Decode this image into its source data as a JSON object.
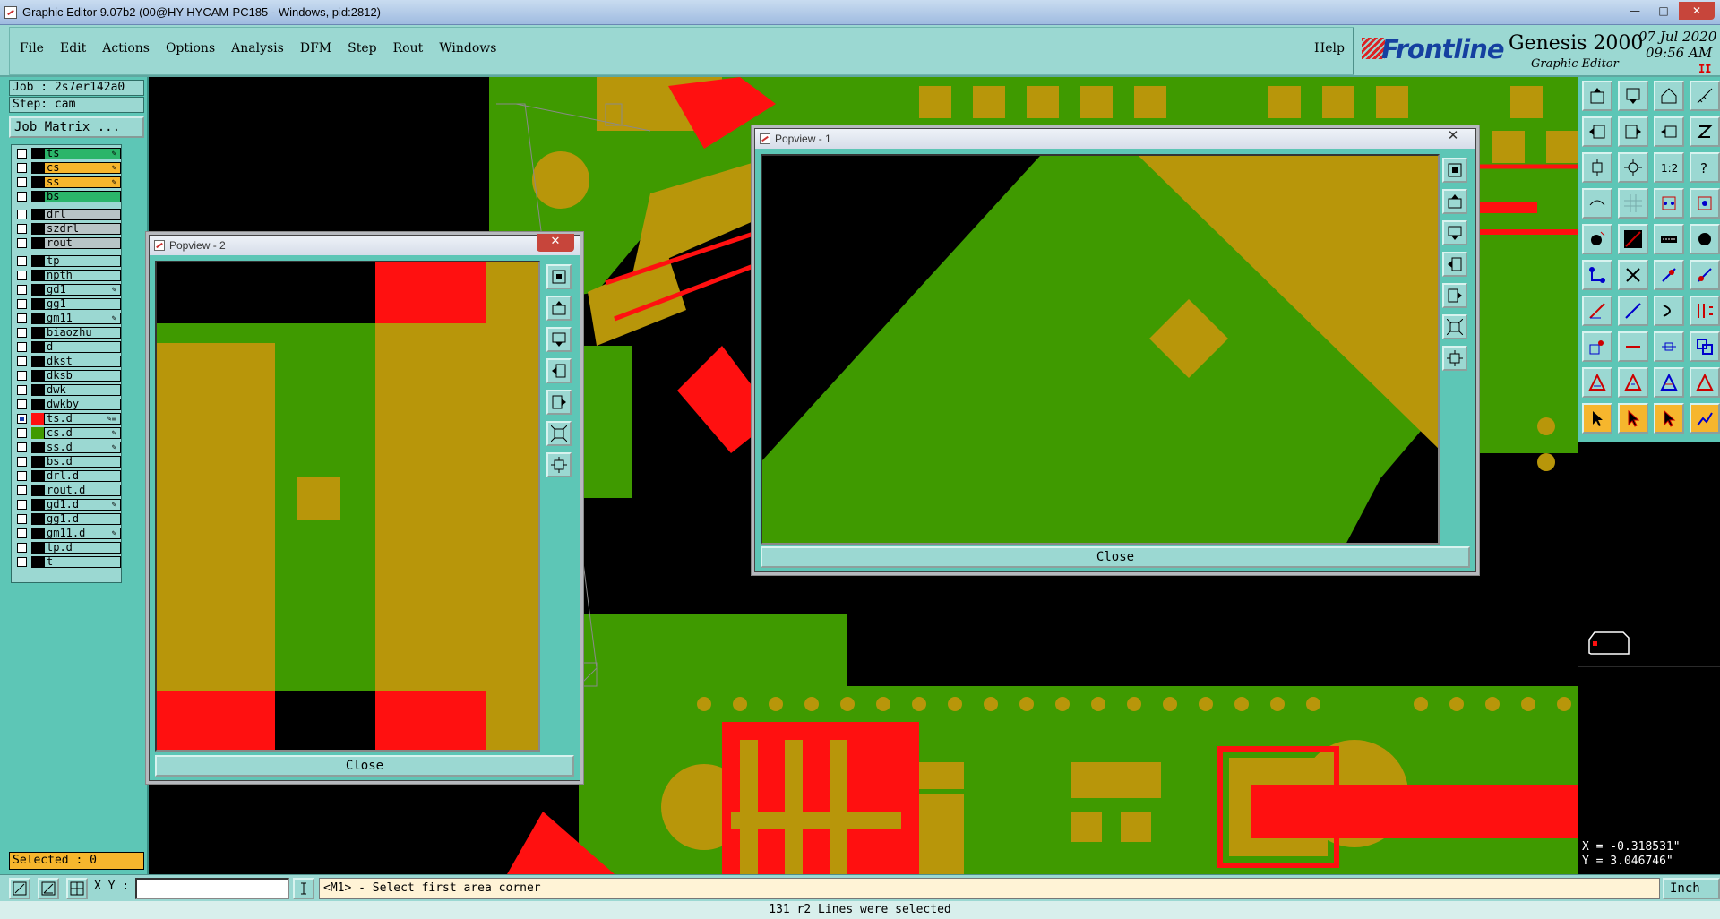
{
  "window": {
    "title": "Graphic Editor 9.07b2 (00@HY-HYCAM-PC185 - Windows, pid:2812)",
    "controls": [
      "minimize-icon",
      "maximize-icon",
      "close-icon"
    ]
  },
  "menu": {
    "items": [
      "File",
      "Edit",
      "Actions",
      "Options",
      "Analysis",
      "DFM",
      "Step",
      "Rout",
      "Windows"
    ],
    "help": "Help"
  },
  "brand": {
    "logo": "Frontline",
    "product": "Genesis 2000",
    "subtitle": "Graphic Editor",
    "date": "07 Jul 2020",
    "time": "09:56 AM",
    "pause": "II"
  },
  "job": {
    "job_label": "Job : 2s7er142a0",
    "step_label": "Step: cam",
    "matrix_button": "Job Matrix ..."
  },
  "layers": [
    {
      "name": "ts",
      "color": "#2bb56a",
      "flag": "✎",
      "group": "board"
    },
    {
      "name": "cs",
      "color": "#f6b62d",
      "flag": "✎",
      "group": "board"
    },
    {
      "name": "ss",
      "color": "#f6b62d",
      "flag": "✎",
      "group": "board"
    },
    {
      "name": "bs",
      "color": "#2bb56a",
      "flag": "",
      "group": "board"
    },
    {
      "name": "drl",
      "color": "#b8c4c6",
      "flag": "",
      "group": "drill"
    },
    {
      "name": "szdrl",
      "color": "#b8c4c6",
      "flag": "",
      "group": "drill"
    },
    {
      "name": "rout",
      "color": "#b8c4c6",
      "flag": "",
      "group": "drill"
    },
    {
      "name": "tp",
      "color": "#9bd8d2",
      "flag": "",
      "group": "misc"
    },
    {
      "name": "npth",
      "color": "#9bd8d2",
      "flag": "",
      "group": "misc"
    },
    {
      "name": "gd1",
      "color": "#9bd8d2",
      "flag": "✎",
      "group": "misc"
    },
    {
      "name": "gg1",
      "color": "#9bd8d2",
      "flag": "",
      "group": "misc"
    },
    {
      "name": "gm11",
      "color": "#9bd8d2",
      "flag": "✎",
      "group": "misc"
    },
    {
      "name": "biaozhu",
      "color": "#9bd8d2",
      "flag": "",
      "group": "misc"
    },
    {
      "name": "d",
      "color": "#9bd8d2",
      "flag": "",
      "group": "misc"
    },
    {
      "name": "dkst",
      "color": "#9bd8d2",
      "flag": "",
      "group": "misc"
    },
    {
      "name": "dksb",
      "color": "#9bd8d2",
      "flag": "",
      "group": "misc"
    },
    {
      "name": "dwk",
      "color": "#9bd8d2",
      "flag": "",
      "group": "misc"
    },
    {
      "name": "dwkby",
      "color": "#9bd8d2",
      "flag": "",
      "group": "misc"
    },
    {
      "name": "ts.d",
      "color": "#9bd8d2",
      "flag": "✎≡",
      "group": "misc",
      "swatch": "#ff1010",
      "active": true
    },
    {
      "name": "cs.d",
      "color": "#9bd8d2",
      "flag": "✎",
      "group": "misc",
      "swatch": "#3f9a00",
      "active": false
    },
    {
      "name": "ss.d",
      "color": "#9bd8d2",
      "flag": "✎",
      "group": "misc",
      "swatch": "#000000"
    },
    {
      "name": "bs.d",
      "color": "#9bd8d2",
      "flag": "",
      "group": "misc"
    },
    {
      "name": "drl.d",
      "color": "#9bd8d2",
      "flag": "",
      "group": "misc"
    },
    {
      "name": "rout.d",
      "color": "#9bd8d2",
      "flag": "",
      "group": "misc"
    },
    {
      "name": "gd1.d",
      "color": "#9bd8d2",
      "flag": "✎",
      "group": "misc"
    },
    {
      "name": "gg1.d",
      "color": "#9bd8d2",
      "flag": "",
      "group": "misc"
    },
    {
      "name": "gm11.d",
      "color": "#9bd8d2",
      "flag": "✎",
      "group": "misc"
    },
    {
      "name": "tp.d",
      "color": "#9bd8d2",
      "flag": "",
      "group": "misc"
    },
    {
      "name": "t",
      "color": "#9bd8d2",
      "flag": "",
      "group": "misc"
    }
  ],
  "selected": "Selected : 0",
  "popview1": {
    "title": "Popview - 1",
    "close_label": "Close"
  },
  "popview2": {
    "title": "Popview - 2",
    "close_label": "Close"
  },
  "coords": {
    "x": "X = -0.318531\"",
    "y": "Y = 3.046746\""
  },
  "command": {
    "xy_label": "X Y :",
    "xy_value": "",
    "prompt": "<M1> - Select first area corner",
    "unit": "Inch"
  },
  "status": "131 r2 Lines were selected",
  "colors": {
    "copper_gold": "#b8960a",
    "green": "#3f9a00",
    "red": "#ff1010",
    "panel": "#9bd8d2",
    "accent": "#5dc6b6",
    "selected_bg": "#f6b62d"
  }
}
